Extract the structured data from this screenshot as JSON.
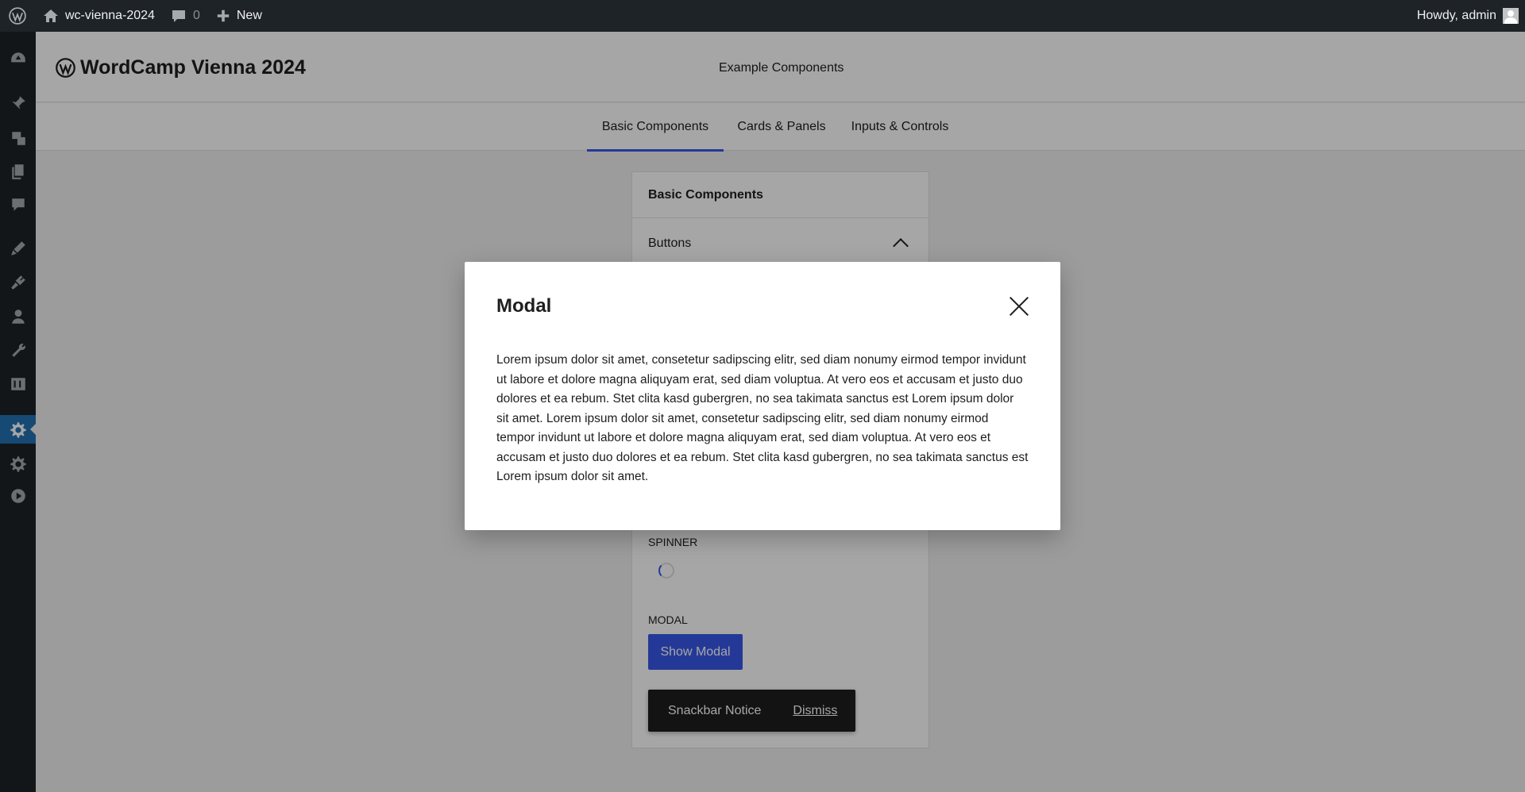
{
  "admin_bar": {
    "site_name": "wc-vienna-2024",
    "comments_count": "0",
    "new_label": "New",
    "greeting": "Howdy, admin"
  },
  "header": {
    "site_title": "WordCamp Vienna 2024",
    "subtitle": "Example Components"
  },
  "tabs": [
    {
      "label": "Basic Components",
      "active": true
    },
    {
      "label": "Cards & Panels",
      "active": false
    },
    {
      "label": "Inputs & Controls",
      "active": false
    }
  ],
  "panel": {
    "title": "Basic Components",
    "section_title": "Buttons",
    "spinner_label": "Spinner",
    "modal_label": "Modal",
    "show_modal_button": "Show Modal",
    "snackbar_text": "Snackbar Notice",
    "snackbar_action": "Dismiss"
  },
  "modal": {
    "title": "Modal",
    "body": "Lorem ipsum dolor sit amet, consetetur sadipscing elitr, sed diam nonumy eirmod tempor invidunt ut labore et dolore magna aliquyam erat, sed diam voluptua. At vero eos et accusam et justo duo dolores et ea rebum. Stet clita kasd gubergren, no sea takimata sanctus est Lorem ipsum dolor sit amet. Lorem ipsum dolor sit amet, consetetur sadipscing elitr, sed diam nonumy eirmod tempor invidunt ut labore et dolore magna aliquyam erat, sed diam voluptua. At vero eos et accusam et justo duo dolores et ea rebum. Stet clita kasd gubergren, no sea takimata sanctus est Lorem ipsum dolor sit amet."
  },
  "sidebar_icons": [
    "dashboard-icon",
    "pin-icon",
    "media-icon",
    "pages-icon",
    "comments-icon",
    "appearance-icon",
    "plugins-icon",
    "users-icon",
    "tools-icon",
    "settings-icon-2",
    "settings-icon",
    "gear-icon",
    "play-icon"
  ],
  "colors": {
    "admin_bg": "#1d2327",
    "accent": "#3858e9",
    "active_menu": "#2271b1"
  }
}
